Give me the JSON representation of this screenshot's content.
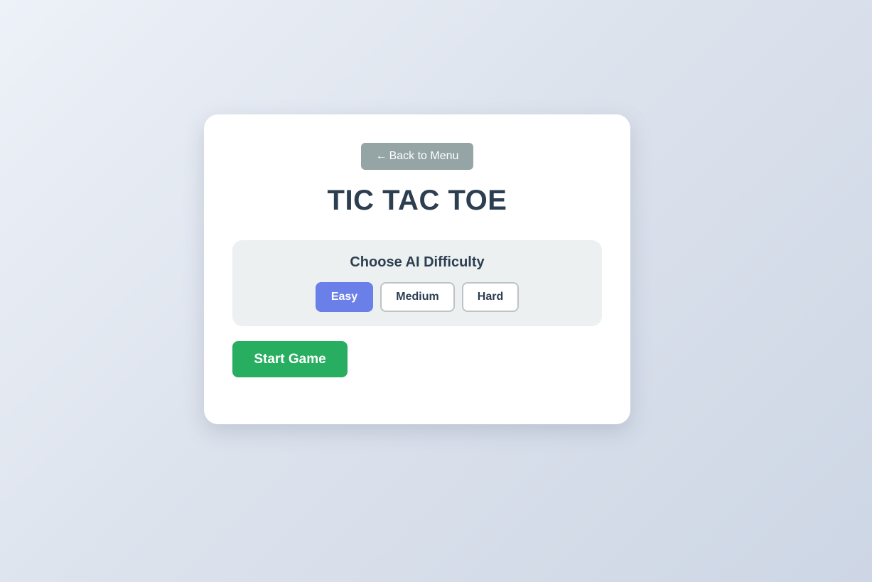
{
  "nav": {
    "back_arrow": "←",
    "back_label": "Back to Menu"
  },
  "game": {
    "title": "TIC TAC TOE"
  },
  "difficulty": {
    "heading": "Choose AI Difficulty",
    "options": [
      {
        "label": "Easy",
        "selected": true
      },
      {
        "label": "Medium",
        "selected": false
      },
      {
        "label": "Hard",
        "selected": false
      }
    ]
  },
  "actions": {
    "start_label": "Start Game"
  },
  "colors": {
    "title": "#2c3e50",
    "back_button": "#95a5a6",
    "selected_difficulty": "#6a7fe8",
    "start_button": "#27ae60",
    "panel_background": "#ecf0f1"
  }
}
